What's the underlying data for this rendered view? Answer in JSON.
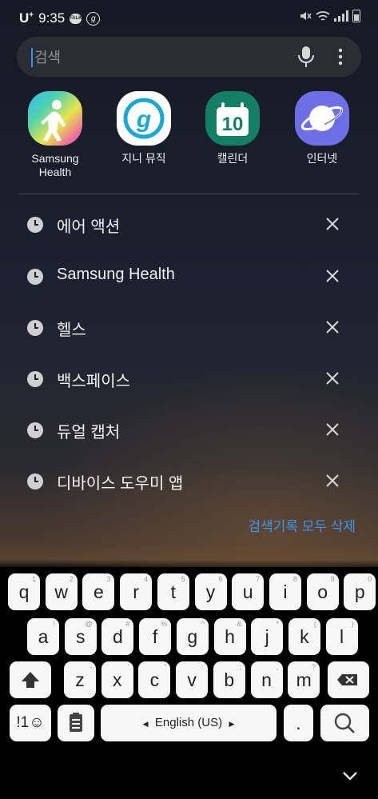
{
  "status_bar": {
    "carrier": "U",
    "carrier_sup": "+",
    "time": "9:35",
    "talk_badge": "TALK",
    "genie_badge": "g"
  },
  "search": {
    "placeholder": "검색"
  },
  "apps": [
    {
      "label": "Samsung Health",
      "icon": "samsung-health-icon"
    },
    {
      "label": "지니 뮤직",
      "icon": "genie-music-icon"
    },
    {
      "label": "캘린더",
      "icon": "calendar-icon",
      "icon_text": "10"
    },
    {
      "label": "인터넷",
      "icon": "internet-icon"
    }
  ],
  "history": [
    {
      "text": "에어 액션"
    },
    {
      "text": "Samsung Health"
    },
    {
      "text": "헬스"
    },
    {
      "text": "백스페이스"
    },
    {
      "text": "듀얼 캡처"
    },
    {
      "text": "디바이스 도우미 앱"
    }
  ],
  "clear_history_label": "검색기록 모두 삭제",
  "keyboard": {
    "row1": [
      {
        "k": "q",
        "h": "1"
      },
      {
        "k": "w",
        "h": "2"
      },
      {
        "k": "e",
        "h": "3"
      },
      {
        "k": "r",
        "h": "4"
      },
      {
        "k": "t",
        "h": "5"
      },
      {
        "k": "y",
        "h": "6"
      },
      {
        "k": "u",
        "h": "7"
      },
      {
        "k": "i",
        "h": "8"
      },
      {
        "k": "o",
        "h": "9"
      },
      {
        "k": "p",
        "h": "0"
      }
    ],
    "row2": [
      {
        "k": "a",
        "h": "!"
      },
      {
        "k": "s",
        "h": "@"
      },
      {
        "k": "d",
        "h": "#"
      },
      {
        "k": "f",
        "h": "%"
      },
      {
        "k": "g",
        "h": "^"
      },
      {
        "k": "h",
        "h": "&"
      },
      {
        "k": "j",
        "h": "*"
      },
      {
        "k": "k",
        "h": "("
      },
      {
        "k": "l",
        "h": ")"
      }
    ],
    "row3": [
      {
        "k": "z",
        "h": "-"
      },
      {
        "k": "x",
        "h": "'"
      },
      {
        "k": "c",
        "h": "\""
      },
      {
        "k": "v",
        "h": ":"
      },
      {
        "k": "b",
        "h": ";"
      },
      {
        "k": "n",
        "h": ","
      },
      {
        "k": "m",
        "h": "?"
      }
    ],
    "symbols_label": "!1☺",
    "space_label": "English (US)",
    "period_label": "."
  }
}
